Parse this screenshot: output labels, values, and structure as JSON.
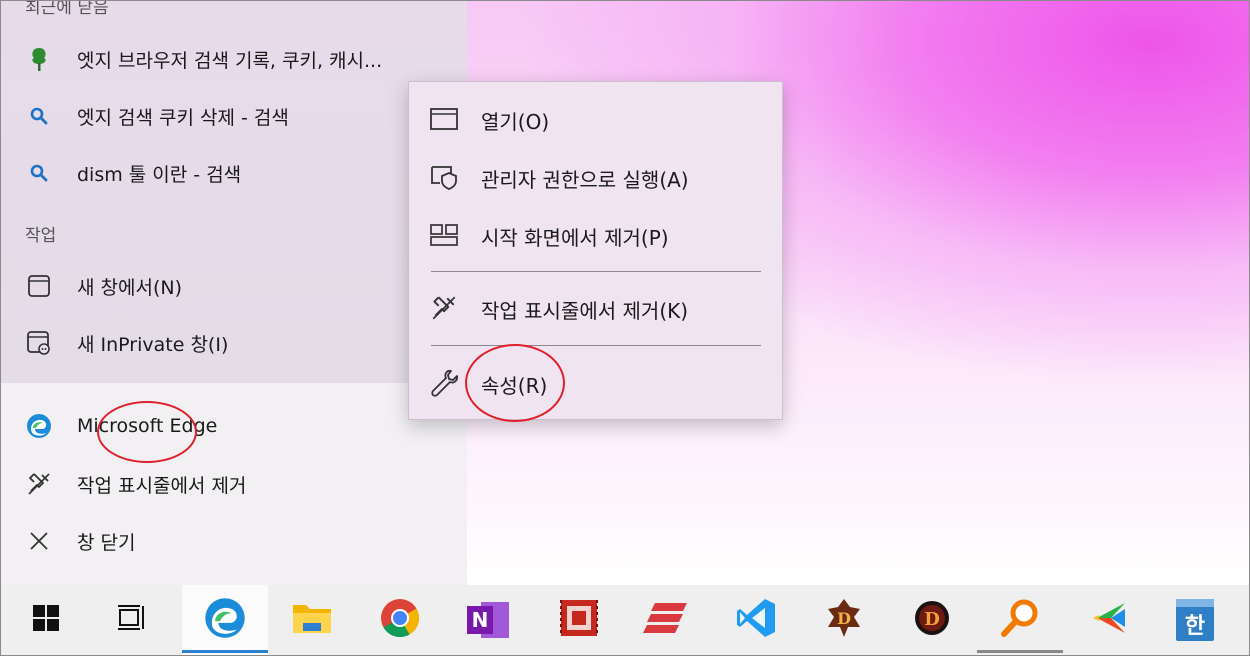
{
  "jump_list": {
    "recent_header": "최근에 닫음",
    "recent": [
      {
        "label": "엣지 브라우저 검색 기록, 쿠키, 캐시...",
        "icon": "tree-icon"
      },
      {
        "label": "엣지 검색 쿠키 삭제 - 검색",
        "icon": "search-icon"
      },
      {
        "label": "dism 툴 이란 - 검색",
        "icon": "search-icon"
      }
    ],
    "tasks_header": "작업",
    "tasks": [
      {
        "label": "새 창에서(N)",
        "icon": "window-icon"
      },
      {
        "label": "새 InPrivate 창(I)",
        "icon": "inprivate-icon"
      }
    ],
    "app": [
      {
        "label": "Microsoft Edge",
        "icon": "edge-icon"
      },
      {
        "label": "작업 표시줄에서 제거",
        "icon": "unpin-icon"
      },
      {
        "label": "창 닫기",
        "icon": "close-icon"
      }
    ]
  },
  "context_menu": {
    "items": [
      {
        "label": "열기(O)",
        "icon": "window-icon"
      },
      {
        "label": "관리자 권한으로 실행(A)",
        "icon": "shield-icon"
      },
      {
        "label": "시작 화면에서 제거(P)",
        "icon": "tiles-icon"
      },
      {
        "label": "작업 표시줄에서 제거(K)",
        "icon": "unpin-icon"
      },
      {
        "label": "속성(R)",
        "icon": "wrench-icon"
      }
    ]
  },
  "taskbar": {
    "items": [
      {
        "icon": "windows-start-icon"
      },
      {
        "icon": "task-view-icon"
      },
      {
        "icon": "edge-icon",
        "active": true
      },
      {
        "icon": "file-explorer-icon"
      },
      {
        "icon": "chrome-icon"
      },
      {
        "icon": "onenote-icon"
      },
      {
        "icon": "red-app-icon"
      },
      {
        "icon": "expressvpn-icon"
      },
      {
        "icon": "vscode-icon"
      },
      {
        "icon": "diablo-icon"
      },
      {
        "icon": "diablo-icon"
      },
      {
        "icon": "search-everything-icon"
      },
      {
        "icon": "colorful-app-icon"
      },
      {
        "icon": "hangul-icon"
      }
    ],
    "onenote_letter": "N",
    "hangul_letter": "한"
  },
  "colors": {
    "accent": "#2d7fd0",
    "annotation": "#e0202a",
    "search_icon": "#1a73c8"
  }
}
